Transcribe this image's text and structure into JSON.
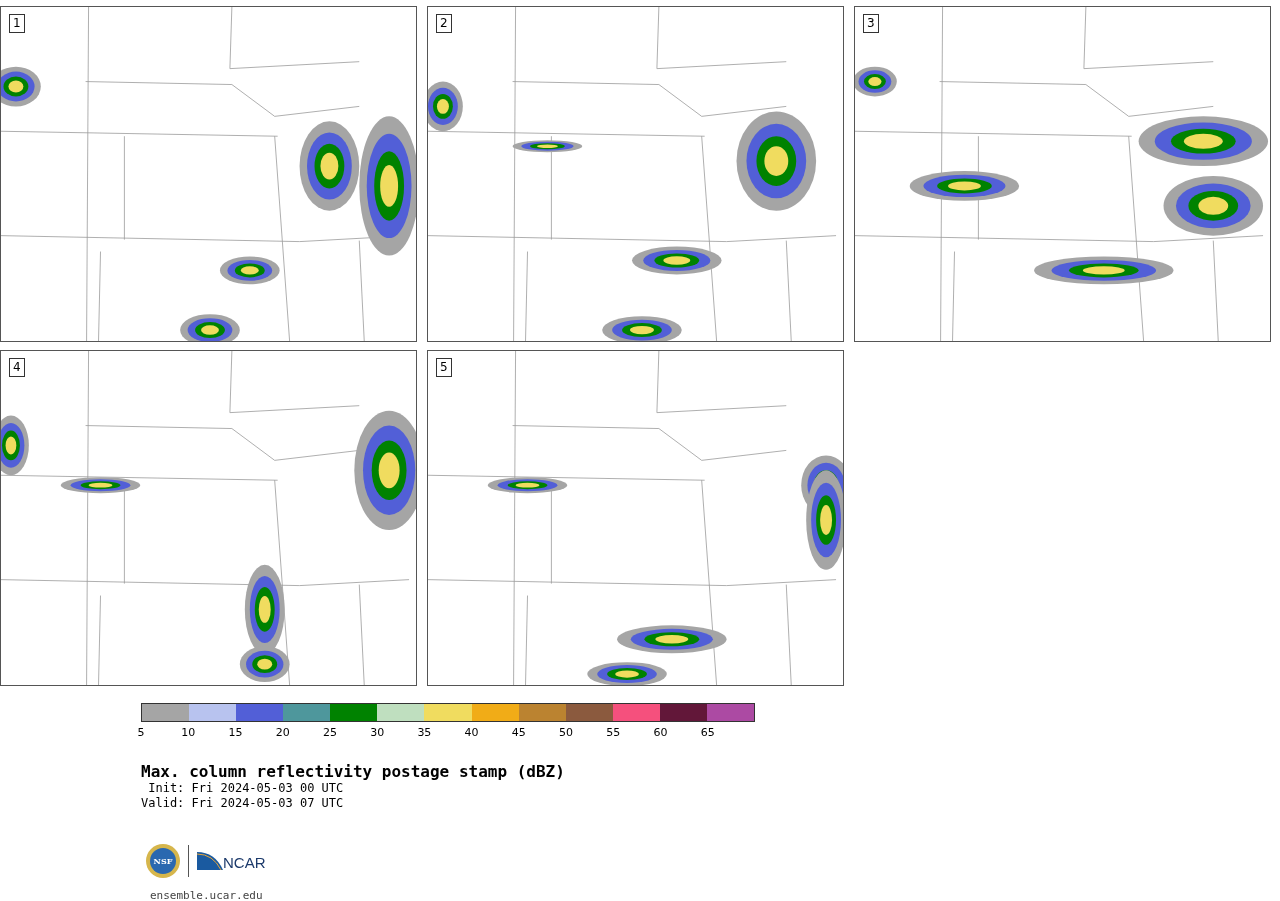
{
  "panels": [
    {
      "label": "1"
    },
    {
      "label": "2"
    },
    {
      "label": "3"
    },
    {
      "label": "4"
    },
    {
      "label": "5"
    }
  ],
  "colorbar": {
    "segments": [
      {
        "color": "#a5a5a5"
      },
      {
        "color": "#b8c3ef"
      },
      {
        "color": "#525fd7"
      },
      {
        "color": "#4e979c"
      },
      {
        "color": "#008200"
      },
      {
        "color": "#bfdfbf"
      },
      {
        "color": "#f0dc5f"
      },
      {
        "color": "#f1ac17"
      },
      {
        "color": "#bb8330"
      },
      {
        "color": "#8b5a3e"
      },
      {
        "color": "#f5507d"
      },
      {
        "color": "#621739"
      },
      {
        "color": "#ac4aa3"
      }
    ],
    "ticks": [
      "5",
      "10",
      "15",
      "20",
      "25",
      "30",
      "35",
      "40",
      "45",
      "50",
      "55",
      "60",
      "65"
    ]
  },
  "title": "Max. column reflectivity postage stamp (dBZ)",
  "init": " Init: Fri 2024-05-03 00 UTC",
  "valid": "Valid: Fri 2024-05-03 07 UTC",
  "logos": {
    "nsf": "NSF",
    "ncar": "NCAR"
  },
  "url": "ensemble.ucar.edu"
}
